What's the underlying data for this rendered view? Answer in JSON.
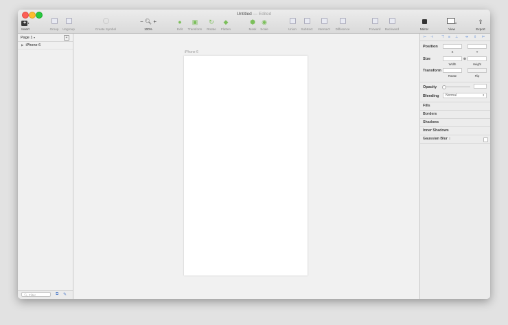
{
  "window": {
    "title": "Untitled",
    "title_status": "— Edited"
  },
  "toolbar": {
    "insert": "Insert",
    "group": "Group",
    "ungroup": "Ungroup",
    "create_symbol": "Create Symbol",
    "zoom_minus": "−",
    "zoom_plus": "+",
    "zoom_level": "100%",
    "edit": "Edit",
    "transform": "Transform",
    "rotate": "Rotate",
    "flatten": "Flatten",
    "mask": "Mask",
    "scale": "Scale",
    "union": "Union",
    "subtract": "Subtract",
    "intersect": "Intersect",
    "difference": "Difference",
    "forward": "Forward",
    "backward": "Backward",
    "mirror": "Mirror",
    "view": "View",
    "export": "Export"
  },
  "sidebar": {
    "page_selector": "Page 1",
    "layers": [
      {
        "name": "iPhone 6"
      }
    ],
    "filter_placeholder": "Filter"
  },
  "canvas": {
    "artboard_name": "iPhone 6"
  },
  "inspector": {
    "position_label": "Position",
    "x_label": "X",
    "y_label": "Y",
    "size_label": "Size",
    "width_label": "Width",
    "height_label": "Height",
    "transform_label": "Transform",
    "rotate_label": "Rotate",
    "flip_label": "Flip",
    "opacity_label": "Opacity",
    "blending_label": "Blending",
    "blending_value": "Normal",
    "fills": "Fills",
    "borders": "Borders",
    "shadows": "Shadows",
    "inner_shadows": "Inner Shadows",
    "gaussian_blur": "Gaussian Blur"
  },
  "colors": {
    "accent": "#4a78c8",
    "toolbar_green": "#7bbf5a",
    "artboard": "#ffffff"
  }
}
